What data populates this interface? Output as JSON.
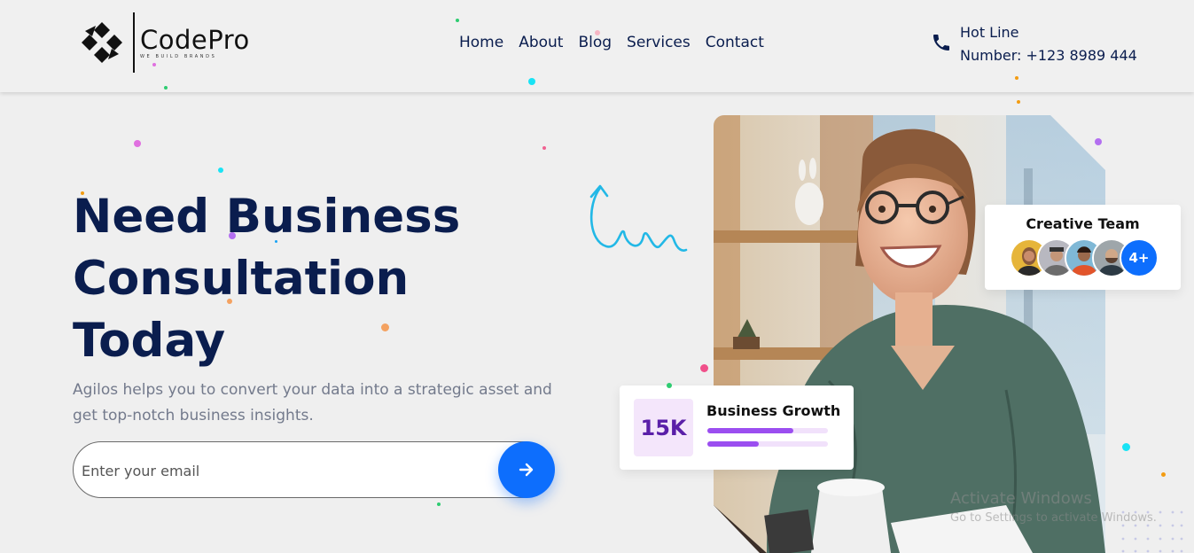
{
  "brand": {
    "name": "CodePro",
    "tagline": "WE BUILD BRANDS"
  },
  "nav": [
    {
      "label": "Home"
    },
    {
      "label": "About"
    },
    {
      "label": "Blog"
    },
    {
      "label": "Services"
    },
    {
      "label": "Contact"
    }
  ],
  "hotline": {
    "line1": "Hot Line",
    "line2": "Number: +123 8989 444",
    "icon": "phone-icon"
  },
  "hero": {
    "title_lines": [
      "Need Business",
      "Consultation",
      "Today"
    ],
    "subtitle": "Agilos helps you to convert your data into a strategic asset and get top-notch business insights.",
    "email_placeholder": "Enter your email",
    "submit_icon": "arrow-right-icon"
  },
  "team_card": {
    "title": "Creative Team",
    "more": "4+"
  },
  "growth_card": {
    "number": "15K",
    "title": "Business Growth",
    "bars": [
      0.71,
      0.43
    ]
  },
  "watermark": {
    "title": "Activate Windows",
    "subtitle": "Go to Settings to activate Windows."
  },
  "colors": {
    "primary": "#0d6efd",
    "heading": "#0a1d4e",
    "muted": "#737a8c",
    "accent_purple": "#9b4ef0"
  }
}
